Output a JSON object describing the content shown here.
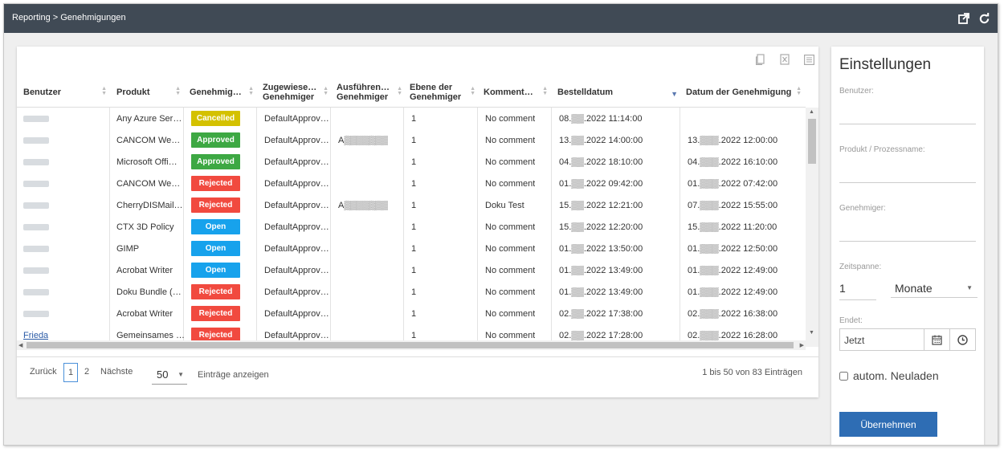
{
  "breadcrumb": "Reporting > Genehmigungen",
  "columns": [
    {
      "key": "user",
      "label": "Benutzer"
    },
    {
      "key": "product",
      "label": "Produkt"
    },
    {
      "key": "status",
      "label": "Genehmig…"
    },
    {
      "key": "assigned",
      "label": "Zugewiese…\nGenehmiger"
    },
    {
      "key": "executing",
      "label": "Ausführen…\nGenehmiger"
    },
    {
      "key": "level",
      "label": "Ebene der\nGenehmiger"
    },
    {
      "key": "comment",
      "label": "Komment…"
    },
    {
      "key": "ordered",
      "label": "Bestelldatum"
    },
    {
      "key": "approved_at",
      "label": "Datum der Genehmigung"
    }
  ],
  "rows": [
    {
      "product": "Any Azure Ser…",
      "status": "Cancelled",
      "assigned": "DefaultApprov…",
      "executing": "",
      "level": "1",
      "comment": "No comment",
      "ordered": "08.▒▒.2022 11:14:00",
      "approved_at": ""
    },
    {
      "product": "CANCOM We…",
      "status": "Approved",
      "assigned": "DefaultApprov…",
      "executing": "A▒▒▒▒▒▒▒",
      "level": "1",
      "comment": "No comment",
      "ordered": "13.▒▒.2022 14:00:00",
      "approved_at": "13.▒▒▒.2022 12:00:00"
    },
    {
      "product": "Microsoft Offi…",
      "status": "Approved",
      "assigned": "DefaultApprov…",
      "executing": "",
      "level": "1",
      "comment": "No comment",
      "ordered": "04.▒▒.2022 18:10:00",
      "approved_at": "04.▒▒▒.2022 16:10:00"
    },
    {
      "product": "CANCOM We…",
      "status": "Rejected",
      "assigned": "DefaultApprov…",
      "executing": "",
      "level": "1",
      "comment": "No comment",
      "ordered": "01.▒▒.2022 09:42:00",
      "approved_at": "01.▒▒▒.2022 07:42:00"
    },
    {
      "product": "CherryDISMail…",
      "status": "Rejected",
      "assigned": "DefaultApprov…",
      "executing": "A▒▒▒▒▒▒▒",
      "level": "1",
      "comment": "Doku Test",
      "ordered": "15.▒▒.2022 12:21:00",
      "approved_at": "07.▒▒▒.2022 15:55:00"
    },
    {
      "product": "CTX 3D Policy",
      "status": "Open",
      "assigned": "DefaultApprov…",
      "executing": "",
      "level": "1",
      "comment": "No comment",
      "ordered": "15.▒▒.2022 12:20:00",
      "approved_at": "15.▒▒▒.2022 11:20:00"
    },
    {
      "product": "GIMP",
      "status": "Open",
      "assigned": "DefaultApprov…",
      "executing": "",
      "level": "1",
      "comment": "No comment",
      "ordered": "01.▒▒.2022 13:50:00",
      "approved_at": "01.▒▒▒.2022 12:50:00"
    },
    {
      "product": "Acrobat Writer",
      "status": "Open",
      "assigned": "DefaultApprov…",
      "executing": "",
      "level": "1",
      "comment": "No comment",
      "ordered": "01.▒▒.2022 13:49:00",
      "approved_at": "01.▒▒▒.2022 12:49:00"
    },
    {
      "product": "Doku Bundle (…",
      "status": "Rejected",
      "assigned": "DefaultApprov…",
      "executing": "",
      "level": "1",
      "comment": "No comment",
      "ordered": "01.▒▒.2022 13:49:00",
      "approved_at": "01.▒▒▒.2022 12:49:00"
    },
    {
      "product": "Acrobat Writer",
      "status": "Rejected",
      "assigned": "DefaultApprov…",
      "executing": "",
      "level": "1",
      "comment": "No comment",
      "ordered": "02.▒▒.2022 17:38:00",
      "approved_at": "02.▒▒▒.2022 16:38:00"
    },
    {
      "product": "Gemeinsames …",
      "status": "Rejected",
      "assigned": "DefaultApprov…",
      "executing": "",
      "level": "1",
      "comment": "No comment",
      "ordered": "02.▒▒.2022 17:28:00",
      "approved_at": "02.▒▒▒.2022 16:28:00",
      "user_link": "Frieda"
    }
  ],
  "status_colors": {
    "Cancelled": "#d4c100",
    "Approved": "#3da843",
    "Rejected": "#f14a3f",
    "Open": "#17a2ec"
  },
  "pager": {
    "prev": "Zurück",
    "pages": [
      "1",
      "2"
    ],
    "current_page": "1",
    "next": "Nächste",
    "page_size": "50",
    "page_size_label": "Einträge anzeigen",
    "info": "1 bis 50 von 83 Einträgen"
  },
  "settings": {
    "title": "Einstellungen",
    "user_label": "Benutzer:",
    "product_label": "Produkt / Prozessname:",
    "approver_label": "Genehmiger:",
    "timespan_label": "Zeitspanne:",
    "timespan_value": "1",
    "timespan_unit": "Monate",
    "ends_label": "Endet:",
    "ends_value": "Jetzt",
    "auto_reload_label": "autom. Neuladen",
    "apply_label": "Übernehmen"
  },
  "icons": {
    "topbar": [
      "external-link-icon",
      "refresh-icon"
    ],
    "export": [
      "copy-icon",
      "excel-icon",
      "csv-icon"
    ]
  },
  "colors": {
    "topbar_bg": "#404a55",
    "primary": "#2e6db4"
  }
}
